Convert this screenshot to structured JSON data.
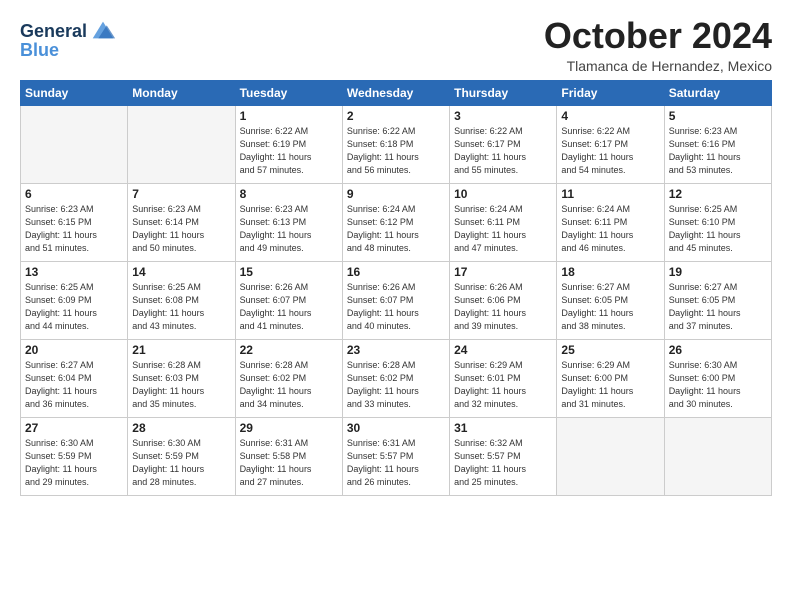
{
  "logo": {
    "line1": "General",
    "line2": "Blue"
  },
  "title": "October 2024",
  "location": "Tlamanca de Hernandez, Mexico",
  "weekdays": [
    "Sunday",
    "Monday",
    "Tuesday",
    "Wednesday",
    "Thursday",
    "Friday",
    "Saturday"
  ],
  "weeks": [
    [
      {
        "day": "",
        "info": ""
      },
      {
        "day": "",
        "info": ""
      },
      {
        "day": "1",
        "info": "Sunrise: 6:22 AM\nSunset: 6:19 PM\nDaylight: 11 hours\nand 57 minutes."
      },
      {
        "day": "2",
        "info": "Sunrise: 6:22 AM\nSunset: 6:18 PM\nDaylight: 11 hours\nand 56 minutes."
      },
      {
        "day": "3",
        "info": "Sunrise: 6:22 AM\nSunset: 6:17 PM\nDaylight: 11 hours\nand 55 minutes."
      },
      {
        "day": "4",
        "info": "Sunrise: 6:22 AM\nSunset: 6:17 PM\nDaylight: 11 hours\nand 54 minutes."
      },
      {
        "day": "5",
        "info": "Sunrise: 6:23 AM\nSunset: 6:16 PM\nDaylight: 11 hours\nand 53 minutes."
      }
    ],
    [
      {
        "day": "6",
        "info": "Sunrise: 6:23 AM\nSunset: 6:15 PM\nDaylight: 11 hours\nand 51 minutes."
      },
      {
        "day": "7",
        "info": "Sunrise: 6:23 AM\nSunset: 6:14 PM\nDaylight: 11 hours\nand 50 minutes."
      },
      {
        "day": "8",
        "info": "Sunrise: 6:23 AM\nSunset: 6:13 PM\nDaylight: 11 hours\nand 49 minutes."
      },
      {
        "day": "9",
        "info": "Sunrise: 6:24 AM\nSunset: 6:12 PM\nDaylight: 11 hours\nand 48 minutes."
      },
      {
        "day": "10",
        "info": "Sunrise: 6:24 AM\nSunset: 6:11 PM\nDaylight: 11 hours\nand 47 minutes."
      },
      {
        "day": "11",
        "info": "Sunrise: 6:24 AM\nSunset: 6:11 PM\nDaylight: 11 hours\nand 46 minutes."
      },
      {
        "day": "12",
        "info": "Sunrise: 6:25 AM\nSunset: 6:10 PM\nDaylight: 11 hours\nand 45 minutes."
      }
    ],
    [
      {
        "day": "13",
        "info": "Sunrise: 6:25 AM\nSunset: 6:09 PM\nDaylight: 11 hours\nand 44 minutes."
      },
      {
        "day": "14",
        "info": "Sunrise: 6:25 AM\nSunset: 6:08 PM\nDaylight: 11 hours\nand 43 minutes."
      },
      {
        "day": "15",
        "info": "Sunrise: 6:26 AM\nSunset: 6:07 PM\nDaylight: 11 hours\nand 41 minutes."
      },
      {
        "day": "16",
        "info": "Sunrise: 6:26 AM\nSunset: 6:07 PM\nDaylight: 11 hours\nand 40 minutes."
      },
      {
        "day": "17",
        "info": "Sunrise: 6:26 AM\nSunset: 6:06 PM\nDaylight: 11 hours\nand 39 minutes."
      },
      {
        "day": "18",
        "info": "Sunrise: 6:27 AM\nSunset: 6:05 PM\nDaylight: 11 hours\nand 38 minutes."
      },
      {
        "day": "19",
        "info": "Sunrise: 6:27 AM\nSunset: 6:05 PM\nDaylight: 11 hours\nand 37 minutes."
      }
    ],
    [
      {
        "day": "20",
        "info": "Sunrise: 6:27 AM\nSunset: 6:04 PM\nDaylight: 11 hours\nand 36 minutes."
      },
      {
        "day": "21",
        "info": "Sunrise: 6:28 AM\nSunset: 6:03 PM\nDaylight: 11 hours\nand 35 minutes."
      },
      {
        "day": "22",
        "info": "Sunrise: 6:28 AM\nSunset: 6:02 PM\nDaylight: 11 hours\nand 34 minutes."
      },
      {
        "day": "23",
        "info": "Sunrise: 6:28 AM\nSunset: 6:02 PM\nDaylight: 11 hours\nand 33 minutes."
      },
      {
        "day": "24",
        "info": "Sunrise: 6:29 AM\nSunset: 6:01 PM\nDaylight: 11 hours\nand 32 minutes."
      },
      {
        "day": "25",
        "info": "Sunrise: 6:29 AM\nSunset: 6:00 PM\nDaylight: 11 hours\nand 31 minutes."
      },
      {
        "day": "26",
        "info": "Sunrise: 6:30 AM\nSunset: 6:00 PM\nDaylight: 11 hours\nand 30 minutes."
      }
    ],
    [
      {
        "day": "27",
        "info": "Sunrise: 6:30 AM\nSunset: 5:59 PM\nDaylight: 11 hours\nand 29 minutes."
      },
      {
        "day": "28",
        "info": "Sunrise: 6:30 AM\nSunset: 5:59 PM\nDaylight: 11 hours\nand 28 minutes."
      },
      {
        "day": "29",
        "info": "Sunrise: 6:31 AM\nSunset: 5:58 PM\nDaylight: 11 hours\nand 27 minutes."
      },
      {
        "day": "30",
        "info": "Sunrise: 6:31 AM\nSunset: 5:57 PM\nDaylight: 11 hours\nand 26 minutes."
      },
      {
        "day": "31",
        "info": "Sunrise: 6:32 AM\nSunset: 5:57 PM\nDaylight: 11 hours\nand 25 minutes."
      },
      {
        "day": "",
        "info": ""
      },
      {
        "day": "",
        "info": ""
      }
    ]
  ]
}
